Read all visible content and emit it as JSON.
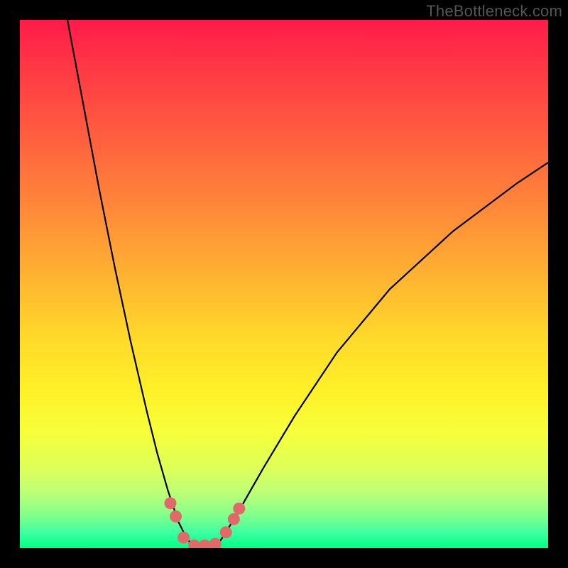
{
  "watermark": "TheBottleneck.com",
  "chart_data": {
    "type": "line",
    "title": "",
    "xlabel": "",
    "ylabel": "",
    "xlim": [
      0,
      100
    ],
    "ylim": [
      0,
      100
    ],
    "grid": false,
    "legend": false,
    "background_gradient": {
      "top": "#ff1a4b",
      "mid": "#ffe62a",
      "bottom": "#00ff88"
    },
    "series": [
      {
        "name": "left-branch",
        "x": [
          9,
          12,
          15,
          18,
          21,
          24,
          26,
          28,
          30,
          31.5,
          33
        ],
        "y": [
          100,
          84,
          68,
          53,
          39,
          26,
          18,
          11,
          5,
          2,
          0
        ]
      },
      {
        "name": "right-branch",
        "x": [
          37,
          39,
          42,
          46,
          52,
          60,
          70,
          82,
          94,
          100
        ],
        "y": [
          0,
          3,
          8,
          15,
          25,
          37,
          49,
          60,
          69,
          73
        ]
      }
    ],
    "markers": {
      "name": "highlight-points",
      "color": "#e06a6a",
      "points": [
        {
          "x": 28.5,
          "y": 8.5
        },
        {
          "x": 29.5,
          "y": 6
        },
        {
          "x": 31,
          "y": 2
        },
        {
          "x": 33,
          "y": 0.5
        },
        {
          "x": 35,
          "y": 0.5
        },
        {
          "x": 37,
          "y": 0.8
        },
        {
          "x": 39,
          "y": 3
        },
        {
          "x": 40.5,
          "y": 5.5
        },
        {
          "x": 41.5,
          "y": 7.5
        }
      ]
    }
  }
}
